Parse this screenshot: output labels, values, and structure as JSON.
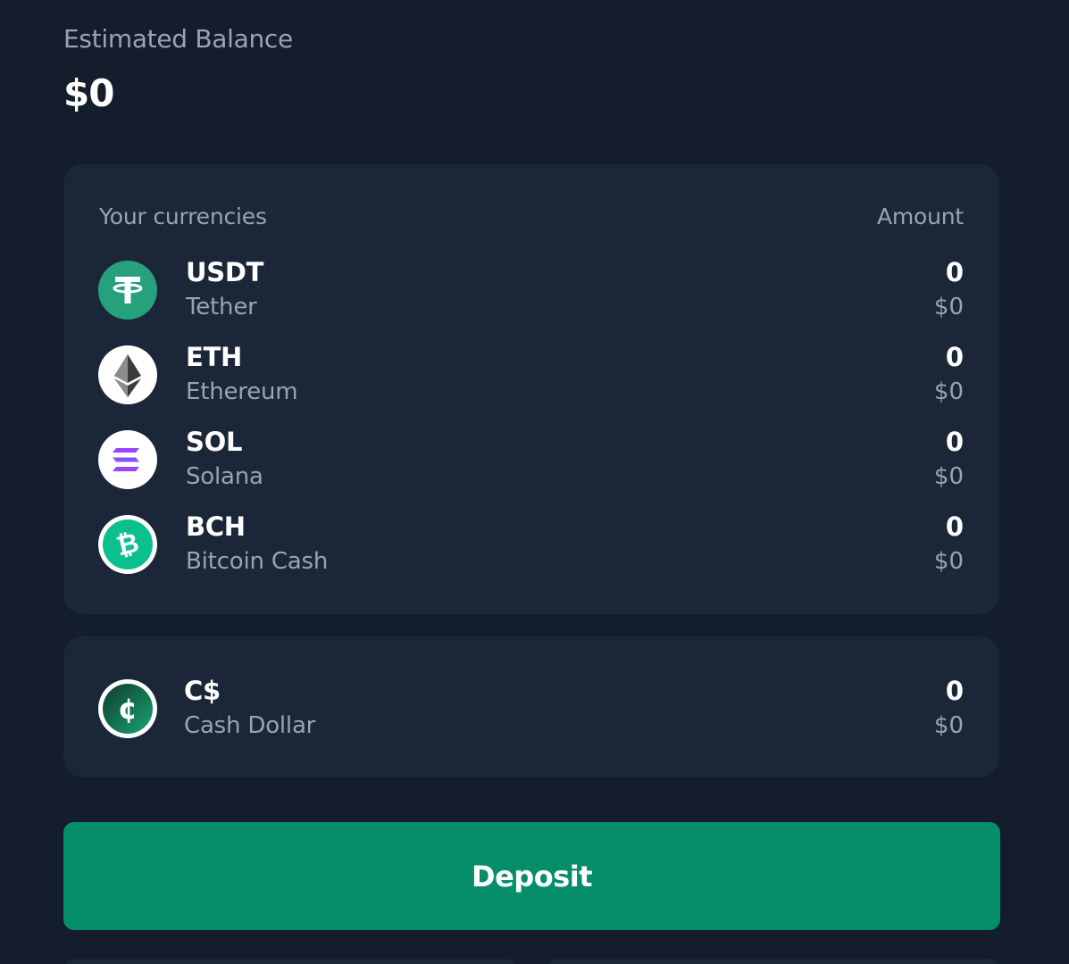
{
  "balance": {
    "label": "Estimated Balance",
    "value": "$0"
  },
  "currencies": {
    "header_left": "Your currencies",
    "header_right": "Amount",
    "items": [
      {
        "symbol": "USDT",
        "name": "Tether",
        "amount": "0",
        "usd": "$0",
        "icon": "tether-icon",
        "color": "#26a17b"
      },
      {
        "symbol": "ETH",
        "name": "Ethereum",
        "amount": "0",
        "usd": "$0",
        "icon": "ethereum-icon",
        "color": "#ffffff"
      },
      {
        "symbol": "SOL",
        "name": "Solana",
        "amount": "0",
        "usd": "$0",
        "icon": "solana-icon",
        "color": "#9945ff"
      },
      {
        "symbol": "BCH",
        "name": "Bitcoin Cash",
        "amount": "0",
        "usd": "$0",
        "icon": "bitcoin-cash-icon",
        "color": "#0ac18e"
      }
    ]
  },
  "cash": {
    "symbol": "C$",
    "name": "Cash Dollar",
    "amount": "0",
    "usd": "$0",
    "icon": "cash-dollar-icon"
  },
  "actions": {
    "deposit_label": "Deposit"
  },
  "colors": {
    "background": "#131d2c",
    "card": "#1b2638",
    "accent": "#058e69",
    "muted_text": "#98a4b3"
  }
}
